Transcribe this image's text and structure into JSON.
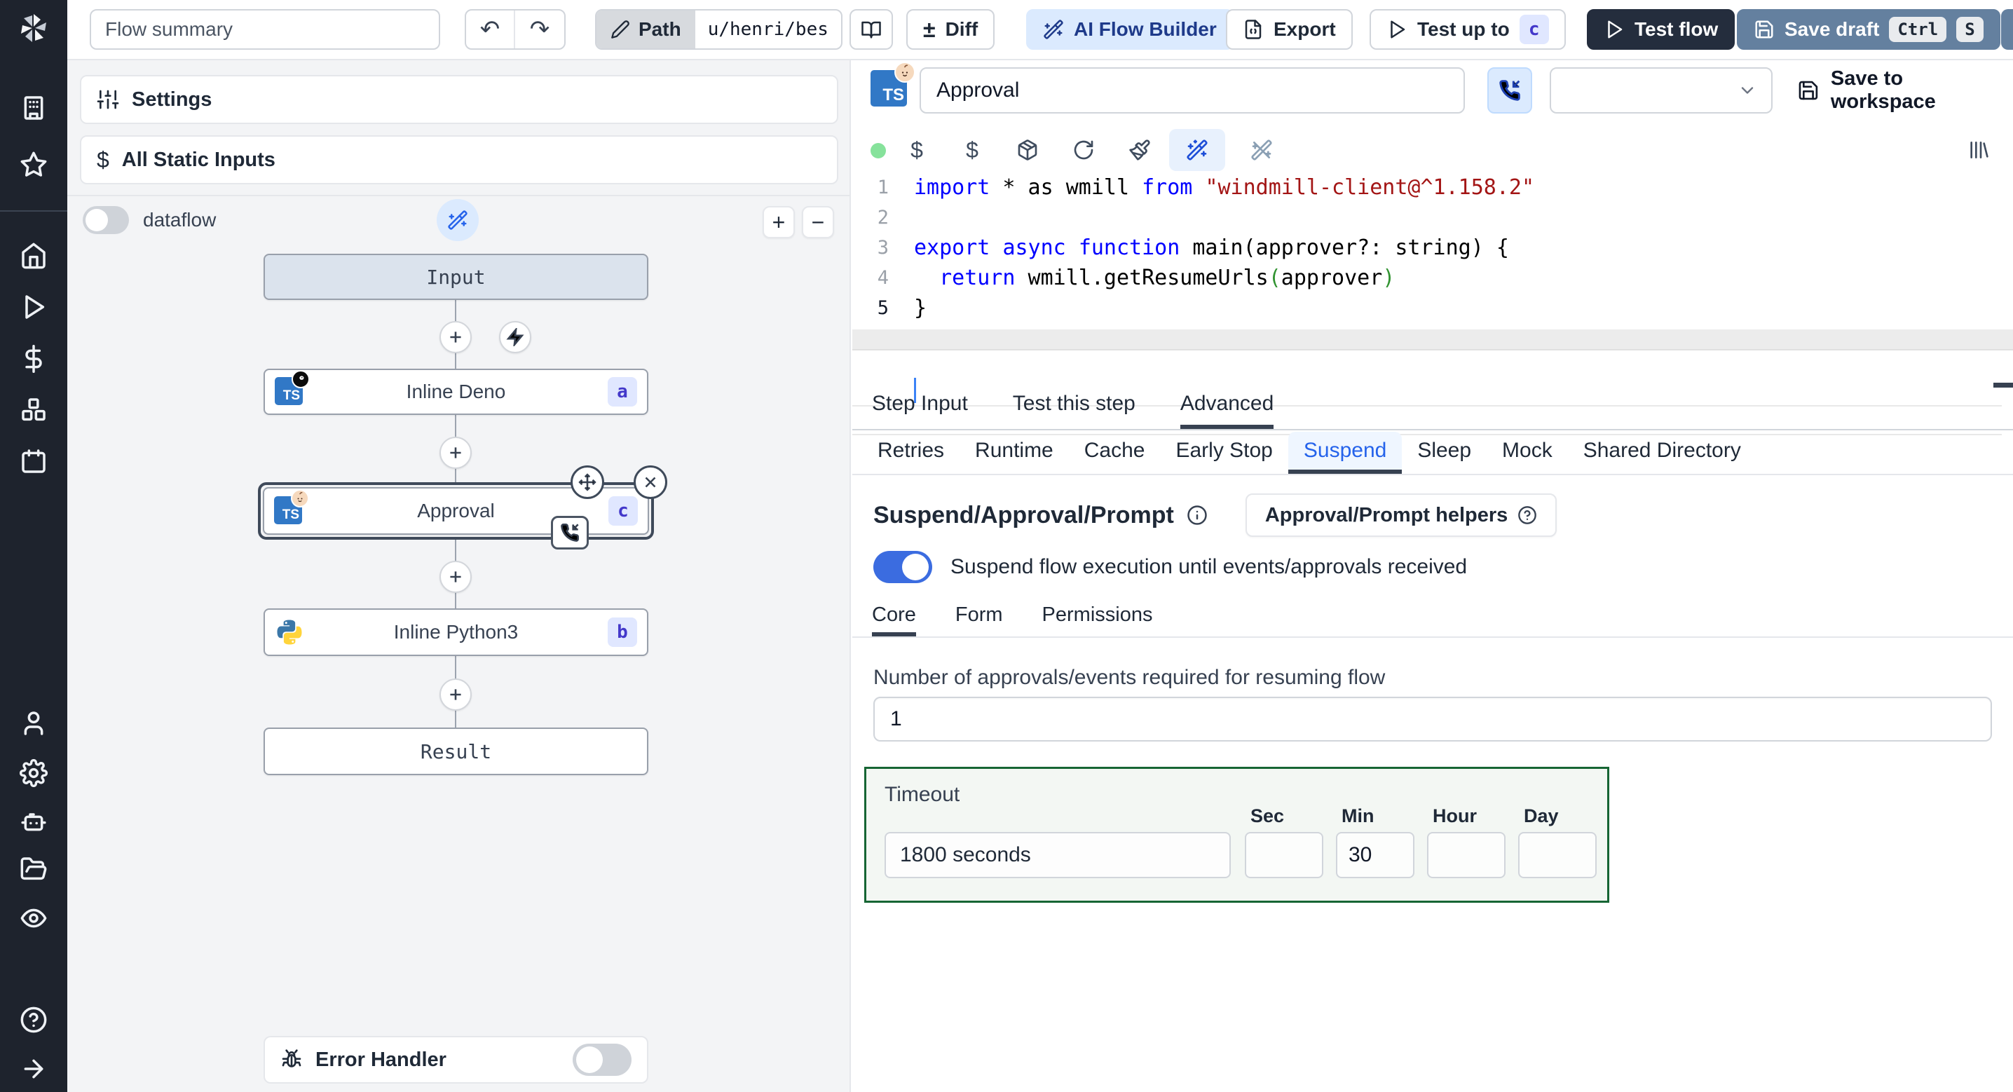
{
  "glyphs": {
    "undo": "↶",
    "redo": "↷",
    "diff": "±",
    "dollar": "$",
    "plus": "+",
    "minus": "−"
  },
  "colors": {
    "sidebar_bg": "#1e232d",
    "panel_bg": "#f3f4f6",
    "accent_blue": "#2563eb",
    "toggle_on": "#3b6ce0",
    "timeout_border_green": "#166534",
    "badge_bg": "#e0e7ff",
    "badge_text": "#4338ca",
    "ai_button_bg": "#dbeafe",
    "test_flow_bg": "#242d3d",
    "save_draft_bg": "#64809f",
    "status_dot_green": "#86e29b",
    "ts_logo_blue": "#3178c6"
  },
  "topbar": {
    "flow_summary_placeholder": "Flow summary",
    "path_label": "Path",
    "path_value": "u/henri/bes",
    "diff_label": "Diff",
    "ai_builder_label": "AI Flow Builder",
    "export_label": "Export",
    "test_up_to_label": "Test up to",
    "test_up_to_badge": "c",
    "test_flow_label": "Test flow",
    "save_draft_label": "Save draft",
    "save_draft_kbd": [
      "Ctrl",
      "S"
    ]
  },
  "flow_panel": {
    "settings_label": "Settings",
    "static_inputs_label": "All Static Inputs",
    "dataflow_label": "dataflow",
    "nodes": {
      "input": {
        "label": "Input"
      },
      "deno": {
        "label": "Inline Deno",
        "badge": "a"
      },
      "approval": {
        "label": "Approval",
        "badge": "c"
      },
      "python": {
        "label": "Inline Python3",
        "badge": "b"
      },
      "result": {
        "label": "Result"
      }
    },
    "error_handler_label": "Error Handler"
  },
  "step_editor": {
    "language_badge": "TS",
    "name_value": "Approval",
    "save_to_workspace_label": "Save to workspace",
    "code": {
      "lines": [
        [
          {
            "t": "import",
            "c": "kw"
          },
          {
            "t": " * as wmill ",
            "c": "df"
          },
          {
            "t": "from",
            "c": "kw"
          },
          {
            "t": " ",
            "c": "df"
          },
          {
            "t": "\"windmill-client@^1.158.2\"",
            "c": "str"
          }
        ],
        [],
        [
          {
            "t": "export",
            "c": "kw"
          },
          {
            "t": " ",
            "c": "df"
          },
          {
            "t": "async",
            "c": "kw"
          },
          {
            "t": " ",
            "c": "df"
          },
          {
            "t": "function",
            "c": "kw"
          },
          {
            "t": " main(approver?: string) {",
            "c": "df"
          }
        ],
        [
          {
            "t": "  ",
            "c": "df"
          },
          {
            "t": "return",
            "c": "kw"
          },
          {
            "t": " wmill.getResumeUrls",
            "c": "df"
          },
          {
            "t": "(",
            "c": "grn"
          },
          {
            "t": "approver",
            "c": "df"
          },
          {
            "t": ")",
            "c": "grn"
          }
        ],
        [
          {
            "t": "}",
            "c": "df"
          }
        ]
      ]
    }
  },
  "tabs": {
    "step": [
      "Step Input",
      "Test this step",
      "Advanced"
    ],
    "advanced": [
      "Retries",
      "Runtime",
      "Cache",
      "Early Stop",
      "Suspend",
      "Sleep",
      "Mock",
      "Shared Directory"
    ],
    "suspend_sections": [
      "Core",
      "Form",
      "Permissions"
    ]
  },
  "suspend": {
    "title": "Suspend/Approval/Prompt",
    "helpers_button_label": "Approval/Prompt helpers",
    "toggle_label": "Suspend flow execution until events/approvals received",
    "approvals_label": "Number of approvals/events required for resuming flow",
    "approvals_value": "1",
    "timeout_label": "Timeout",
    "timeout_value": "1800 seconds",
    "timeout_units": [
      "Sec",
      "Min",
      "Hour",
      "Day"
    ],
    "timeout_unit_values": {
      "sec": "",
      "min": "30",
      "hour": "",
      "day": ""
    }
  }
}
